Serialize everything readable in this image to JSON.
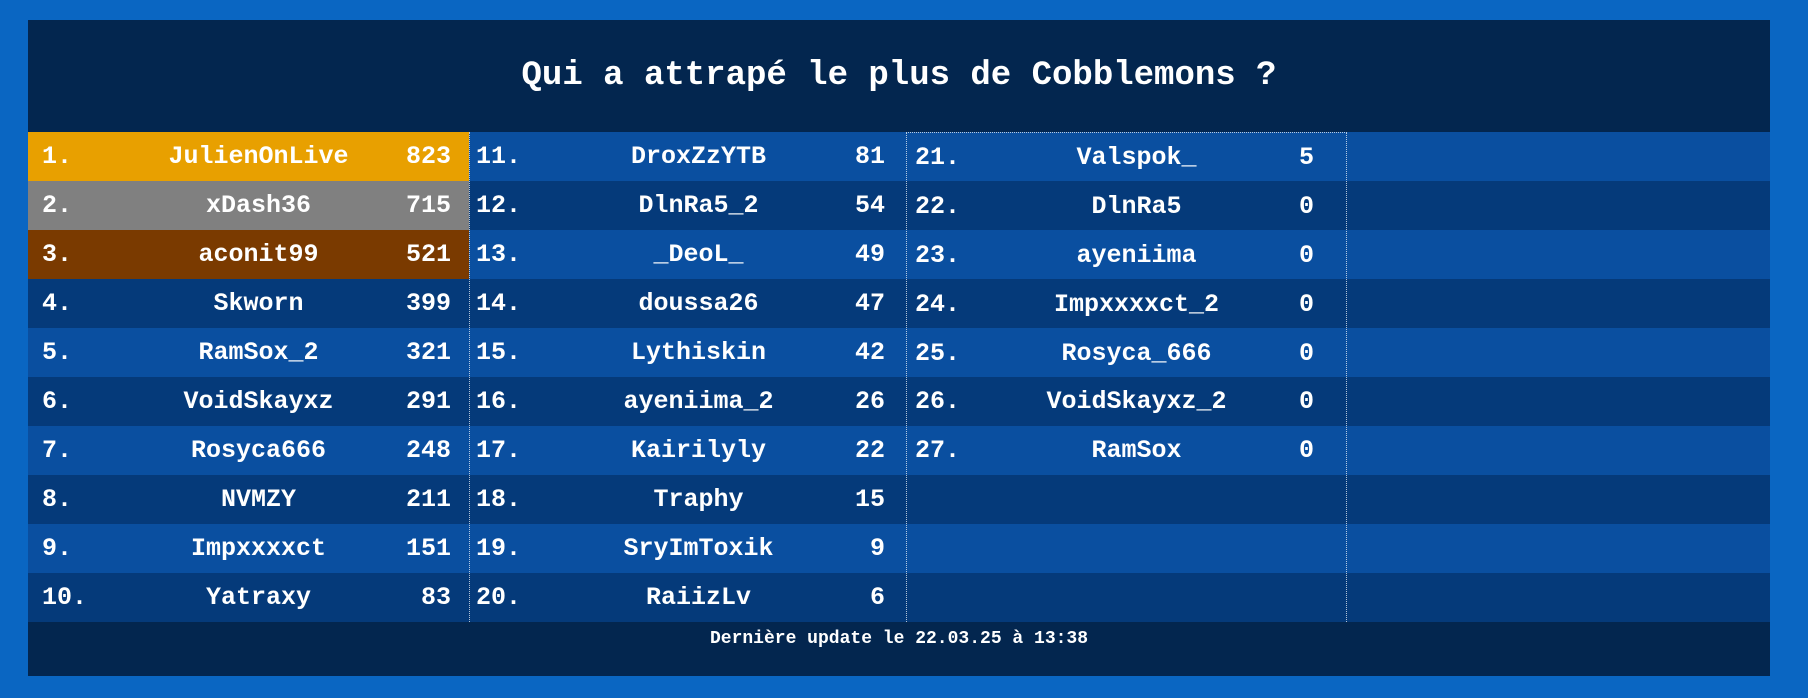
{
  "title": "Qui a attrapé le plus de Cobblemons ?",
  "footer": "Dernière update le 22.03.25 à 13:38",
  "colors": {
    "outer_background": "#0a66c2",
    "panel_background": "#03264f",
    "stripe_light": "#0a4fa0",
    "stripe_dark": "#053a7a",
    "gold": "#e8a000",
    "silver": "#808080",
    "bronze": "#7a3a00",
    "text": "#ffffff"
  },
  "leaderboard": {
    "column1": [
      {
        "rank": "1.",
        "name": "JulienOnLive",
        "count": "823",
        "medal": "gold"
      },
      {
        "rank": "2.",
        "name": "xDash36",
        "count": "715",
        "medal": "silver"
      },
      {
        "rank": "3.",
        "name": "aconit99",
        "count": "521",
        "medal": "bronze"
      },
      {
        "rank": "4.",
        "name": "Skworn",
        "count": "399"
      },
      {
        "rank": "5.",
        "name": "RamSox_2",
        "count": "321"
      },
      {
        "rank": "6.",
        "name": "VoidSkayxz",
        "count": "291"
      },
      {
        "rank": "7.",
        "name": "Rosyca666",
        "count": "248"
      },
      {
        "rank": "8.",
        "name": "NVMZY",
        "count": "211"
      },
      {
        "rank": "9.",
        "name": "Impxxxxct",
        "count": "151"
      },
      {
        "rank": "10.",
        "name": "Yatraxy",
        "count": "83"
      }
    ],
    "column2": [
      {
        "rank": "11.",
        "name": "DroxZzYTB",
        "count": "81"
      },
      {
        "rank": "12.",
        "name": "DlnRa5_2",
        "count": "54"
      },
      {
        "rank": "13.",
        "name": "_DeoL_",
        "count": "49"
      },
      {
        "rank": "14.",
        "name": "doussa26",
        "count": "47"
      },
      {
        "rank": "15.",
        "name": "Lythiskin",
        "count": "42"
      },
      {
        "rank": "16.",
        "name": "ayeniima_2",
        "count": "26"
      },
      {
        "rank": "17.",
        "name": "Kairilyly",
        "count": "22"
      },
      {
        "rank": "18.",
        "name": "Traphy",
        "count": "15"
      },
      {
        "rank": "19.",
        "name": "SryImToxik",
        "count": "9"
      },
      {
        "rank": "20.",
        "name": "RaiizLv",
        "count": "6"
      }
    ],
    "column3": [
      {
        "rank": "21.",
        "name": "Valspok_",
        "count": "5"
      },
      {
        "rank": "22.",
        "name": "DlnRa5",
        "count": "0"
      },
      {
        "rank": "23.",
        "name": "ayeniima",
        "count": "0"
      },
      {
        "rank": "24.",
        "name": "Impxxxxct_2",
        "count": "0"
      },
      {
        "rank": "25.",
        "name": "Rosyca_666",
        "count": "0"
      },
      {
        "rank": "26.",
        "name": "VoidSkayxz_2",
        "count": "0"
      },
      {
        "rank": "27.",
        "name": "RamSox",
        "count": "0"
      }
    ]
  }
}
